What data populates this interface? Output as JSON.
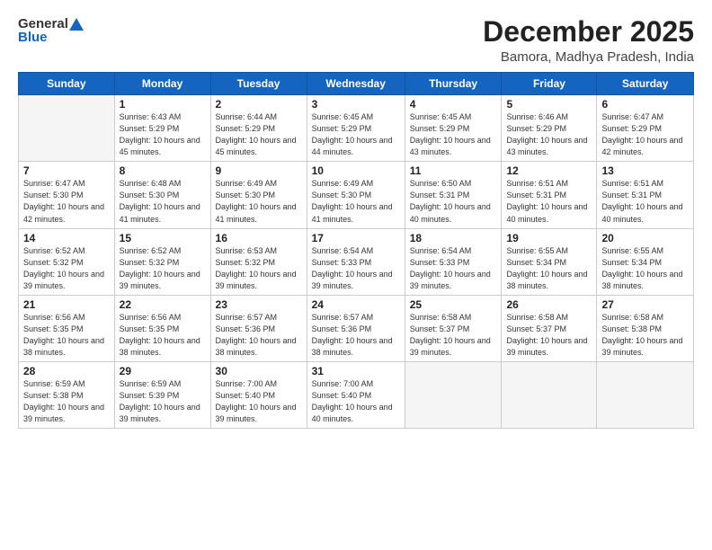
{
  "header": {
    "logo_general": "General",
    "logo_blue": "Blue",
    "month": "December 2025",
    "location": "Bamora, Madhya Pradesh, India"
  },
  "weekdays": [
    "Sunday",
    "Monday",
    "Tuesday",
    "Wednesday",
    "Thursday",
    "Friday",
    "Saturday"
  ],
  "weeks": [
    [
      {
        "day": "",
        "sunrise": "",
        "sunset": "",
        "daylight": "",
        "empty": true
      },
      {
        "day": "1",
        "sunrise": "Sunrise: 6:43 AM",
        "sunset": "Sunset: 5:29 PM",
        "daylight": "Daylight: 10 hours and 45 minutes."
      },
      {
        "day": "2",
        "sunrise": "Sunrise: 6:44 AM",
        "sunset": "Sunset: 5:29 PM",
        "daylight": "Daylight: 10 hours and 45 minutes."
      },
      {
        "day": "3",
        "sunrise": "Sunrise: 6:45 AM",
        "sunset": "Sunset: 5:29 PM",
        "daylight": "Daylight: 10 hours and 44 minutes."
      },
      {
        "day": "4",
        "sunrise": "Sunrise: 6:45 AM",
        "sunset": "Sunset: 5:29 PM",
        "daylight": "Daylight: 10 hours and 43 minutes."
      },
      {
        "day": "5",
        "sunrise": "Sunrise: 6:46 AM",
        "sunset": "Sunset: 5:29 PM",
        "daylight": "Daylight: 10 hours and 43 minutes."
      },
      {
        "day": "6",
        "sunrise": "Sunrise: 6:47 AM",
        "sunset": "Sunset: 5:29 PM",
        "daylight": "Daylight: 10 hours and 42 minutes."
      }
    ],
    [
      {
        "day": "7",
        "sunrise": "Sunrise: 6:47 AM",
        "sunset": "Sunset: 5:30 PM",
        "daylight": "Daylight: 10 hours and 42 minutes."
      },
      {
        "day": "8",
        "sunrise": "Sunrise: 6:48 AM",
        "sunset": "Sunset: 5:30 PM",
        "daylight": "Daylight: 10 hours and 41 minutes."
      },
      {
        "day": "9",
        "sunrise": "Sunrise: 6:49 AM",
        "sunset": "Sunset: 5:30 PM",
        "daylight": "Daylight: 10 hours and 41 minutes."
      },
      {
        "day": "10",
        "sunrise": "Sunrise: 6:49 AM",
        "sunset": "Sunset: 5:30 PM",
        "daylight": "Daylight: 10 hours and 41 minutes."
      },
      {
        "day": "11",
        "sunrise": "Sunrise: 6:50 AM",
        "sunset": "Sunset: 5:31 PM",
        "daylight": "Daylight: 10 hours and 40 minutes."
      },
      {
        "day": "12",
        "sunrise": "Sunrise: 6:51 AM",
        "sunset": "Sunset: 5:31 PM",
        "daylight": "Daylight: 10 hours and 40 minutes."
      },
      {
        "day": "13",
        "sunrise": "Sunrise: 6:51 AM",
        "sunset": "Sunset: 5:31 PM",
        "daylight": "Daylight: 10 hours and 40 minutes."
      }
    ],
    [
      {
        "day": "14",
        "sunrise": "Sunrise: 6:52 AM",
        "sunset": "Sunset: 5:32 PM",
        "daylight": "Daylight: 10 hours and 39 minutes."
      },
      {
        "day": "15",
        "sunrise": "Sunrise: 6:52 AM",
        "sunset": "Sunset: 5:32 PM",
        "daylight": "Daylight: 10 hours and 39 minutes."
      },
      {
        "day": "16",
        "sunrise": "Sunrise: 6:53 AM",
        "sunset": "Sunset: 5:32 PM",
        "daylight": "Daylight: 10 hours and 39 minutes."
      },
      {
        "day": "17",
        "sunrise": "Sunrise: 6:54 AM",
        "sunset": "Sunset: 5:33 PM",
        "daylight": "Daylight: 10 hours and 39 minutes."
      },
      {
        "day": "18",
        "sunrise": "Sunrise: 6:54 AM",
        "sunset": "Sunset: 5:33 PM",
        "daylight": "Daylight: 10 hours and 39 minutes."
      },
      {
        "day": "19",
        "sunrise": "Sunrise: 6:55 AM",
        "sunset": "Sunset: 5:34 PM",
        "daylight": "Daylight: 10 hours and 38 minutes."
      },
      {
        "day": "20",
        "sunrise": "Sunrise: 6:55 AM",
        "sunset": "Sunset: 5:34 PM",
        "daylight": "Daylight: 10 hours and 38 minutes."
      }
    ],
    [
      {
        "day": "21",
        "sunrise": "Sunrise: 6:56 AM",
        "sunset": "Sunset: 5:35 PM",
        "daylight": "Daylight: 10 hours and 38 minutes."
      },
      {
        "day": "22",
        "sunrise": "Sunrise: 6:56 AM",
        "sunset": "Sunset: 5:35 PM",
        "daylight": "Daylight: 10 hours and 38 minutes."
      },
      {
        "day": "23",
        "sunrise": "Sunrise: 6:57 AM",
        "sunset": "Sunset: 5:36 PM",
        "daylight": "Daylight: 10 hours and 38 minutes."
      },
      {
        "day": "24",
        "sunrise": "Sunrise: 6:57 AM",
        "sunset": "Sunset: 5:36 PM",
        "daylight": "Daylight: 10 hours and 38 minutes."
      },
      {
        "day": "25",
        "sunrise": "Sunrise: 6:58 AM",
        "sunset": "Sunset: 5:37 PM",
        "daylight": "Daylight: 10 hours and 39 minutes."
      },
      {
        "day": "26",
        "sunrise": "Sunrise: 6:58 AM",
        "sunset": "Sunset: 5:37 PM",
        "daylight": "Daylight: 10 hours and 39 minutes."
      },
      {
        "day": "27",
        "sunrise": "Sunrise: 6:58 AM",
        "sunset": "Sunset: 5:38 PM",
        "daylight": "Daylight: 10 hours and 39 minutes."
      }
    ],
    [
      {
        "day": "28",
        "sunrise": "Sunrise: 6:59 AM",
        "sunset": "Sunset: 5:38 PM",
        "daylight": "Daylight: 10 hours and 39 minutes."
      },
      {
        "day": "29",
        "sunrise": "Sunrise: 6:59 AM",
        "sunset": "Sunset: 5:39 PM",
        "daylight": "Daylight: 10 hours and 39 minutes."
      },
      {
        "day": "30",
        "sunrise": "Sunrise: 7:00 AM",
        "sunset": "Sunset: 5:40 PM",
        "daylight": "Daylight: 10 hours and 39 minutes."
      },
      {
        "day": "31",
        "sunrise": "Sunrise: 7:00 AM",
        "sunset": "Sunset: 5:40 PM",
        "daylight": "Daylight: 10 hours and 40 minutes."
      },
      {
        "day": "",
        "sunrise": "",
        "sunset": "",
        "daylight": "",
        "empty": true
      },
      {
        "day": "",
        "sunrise": "",
        "sunset": "",
        "daylight": "",
        "empty": true
      },
      {
        "day": "",
        "sunrise": "",
        "sunset": "",
        "daylight": "",
        "empty": true
      }
    ]
  ]
}
